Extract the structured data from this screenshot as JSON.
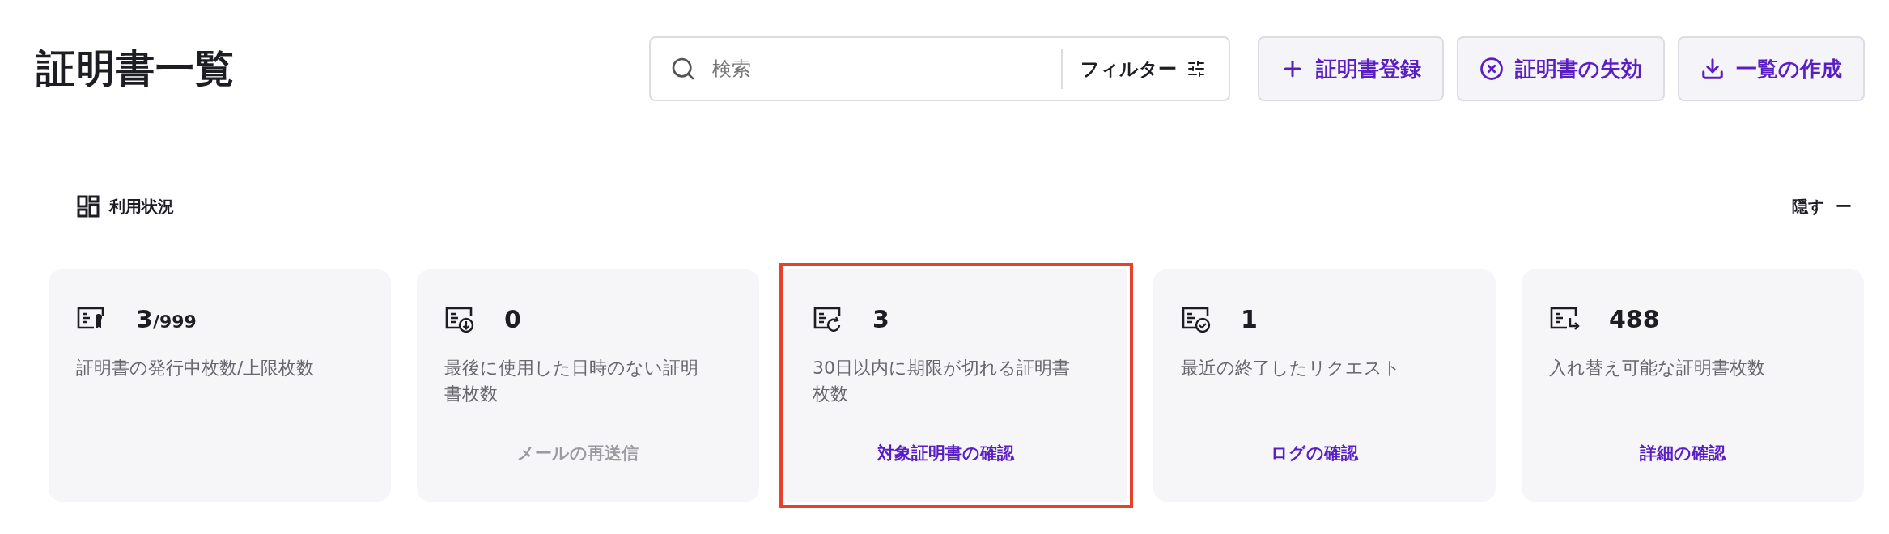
{
  "title": "証明書一覧",
  "search": {
    "placeholder": "検索"
  },
  "filter": {
    "label": "フィルター"
  },
  "actions": [
    {
      "kind": "add",
      "label": "証明書登録"
    },
    {
      "kind": "revoke",
      "label": "証明書の失効"
    },
    {
      "kind": "download",
      "label": "一覧の作成"
    }
  ],
  "usage": {
    "title": "利用状況",
    "toggle": "隠す",
    "toggle_symbol": "ー"
  },
  "cards": [
    {
      "kind": "issued",
      "value": "3",
      "limit": "/999",
      "description": "証明書の発行中枚数/上限枚数",
      "highlighted": false
    },
    {
      "kind": "unused",
      "value": "0",
      "description": "最後に使用した日時のない証明書枚数",
      "link": "メールの再送信",
      "disabled": true,
      "highlighted": false
    },
    {
      "kind": "expiring",
      "value": "3",
      "description": "30日以内に期限が切れる証明書枚数",
      "link": "対象証明書の確認",
      "disabled": false,
      "highlighted": true
    },
    {
      "kind": "completed",
      "value": "1",
      "description": "最近の終了したリクエスト",
      "link": "ログの確認",
      "disabled": false,
      "highlighted": false
    },
    {
      "kind": "replaceable",
      "value": "488",
      "description": "入れ替え可能な証明書枚数",
      "link": "詳細の確認",
      "disabled": false,
      "highlighted": false
    }
  ]
}
